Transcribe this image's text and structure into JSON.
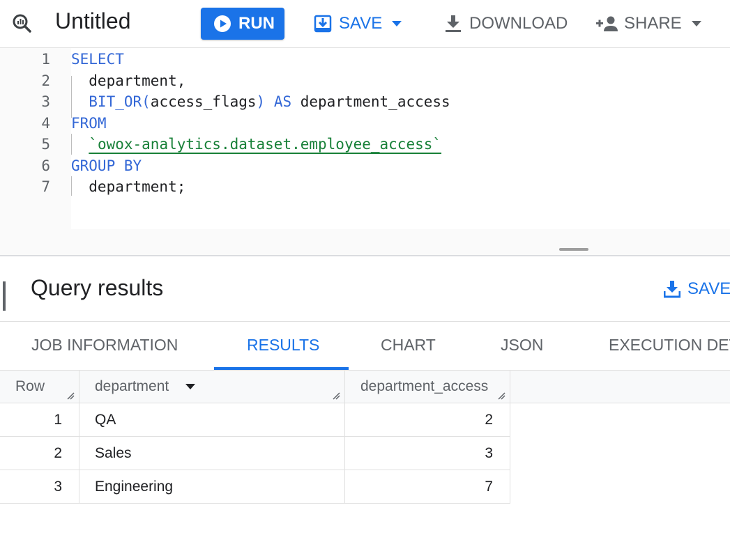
{
  "toolbar": {
    "query_icon": "query-magnifier-icon",
    "title": "Untitled",
    "run_label": "RUN",
    "save_label": "SAVE",
    "download_label": "DOWNLOAD",
    "share_label": "SHARE"
  },
  "editor": {
    "lines": [
      {
        "num": "1",
        "tokens": [
          {
            "t": "SELECT",
            "c": "kw"
          }
        ]
      },
      {
        "num": "2",
        "tokens": [
          {
            "t": "  department,",
            "c": "plain"
          }
        ]
      },
      {
        "num": "3",
        "tokens": [
          {
            "t": "  BIT_OR(",
            "c": "fn"
          },
          {
            "t": "access_flags",
            "c": "plain"
          },
          {
            "t": ")",
            "c": "fn"
          },
          {
            "t": " AS ",
            "c": "kw"
          },
          {
            "t": "department_access",
            "c": "plain"
          }
        ]
      },
      {
        "num": "4",
        "tokens": [
          {
            "t": "FROM",
            "c": "kw"
          }
        ]
      },
      {
        "num": "5",
        "tokens": [
          {
            "t": "  ",
            "c": "plain"
          },
          {
            "t": "`owox-analytics.dataset.employee_access`",
            "c": "str"
          }
        ]
      },
      {
        "num": "6",
        "tokens": [
          {
            "t": "GROUP BY",
            "c": "kw"
          }
        ]
      },
      {
        "num": "7",
        "tokens": [
          {
            "t": "  department;",
            "c": "plain"
          }
        ]
      }
    ]
  },
  "results": {
    "title": "Query results",
    "save_label": "SAVE",
    "tabs": [
      {
        "label": "JOB INFORMATION",
        "active": false
      },
      {
        "label": "RESULTS",
        "active": true
      },
      {
        "label": "CHART",
        "active": false
      },
      {
        "label": "JSON",
        "active": false
      },
      {
        "label": "EXECUTION DET",
        "active": false
      }
    ],
    "columns": [
      "Row",
      "department",
      "department_access"
    ],
    "rows": [
      {
        "row": "1",
        "department": "QA",
        "department_access": "2"
      },
      {
        "row": "2",
        "department": "Sales",
        "department_access": "3"
      },
      {
        "row": "3",
        "department": "Engineering",
        "department_access": "7"
      }
    ]
  },
  "colors": {
    "accent": "#1a73e8",
    "keyword": "#3367d6",
    "string": "#188038",
    "muted_text": "#5f6368"
  }
}
